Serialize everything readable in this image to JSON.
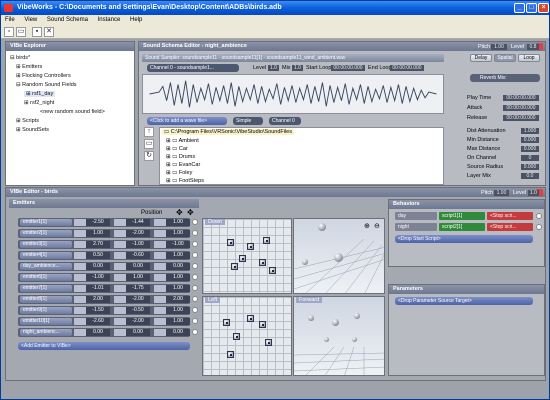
{
  "app": {
    "title": "VibeWorks - C:\\Documents and Settings\\Evan\\Desktop\\Content\\ADBs\\birds.adb",
    "menu": [
      "File",
      "View",
      "Sound Schema",
      "Instance",
      "Help"
    ],
    "window_buttons": [
      "_",
      "□",
      "×"
    ]
  },
  "explorer": {
    "title": "VIBe Explorer",
    "items": [
      {
        "label": "birds*",
        "toggle": "-"
      },
      {
        "label": "Emitters",
        "toggle": "+"
      },
      {
        "label": "Flocking Controllers",
        "toggle": "+"
      },
      {
        "label": "Random Sound Fields",
        "toggle": "-"
      },
      {
        "label": "rsf1_day",
        "toggle": "+"
      },
      {
        "label": "rsf2_night",
        "toggle": "+"
      },
      {
        "label": "<new random sound field>",
        "toggle": ""
      },
      {
        "label": "Scripts",
        "toggle": "+"
      },
      {
        "label": "SoundSets",
        "toggle": "+"
      }
    ]
  },
  "schema_editor": {
    "title": "Sound Schema Editor - night_ambience",
    "pitch_label": "Pitch",
    "pitch_value": "1.00",
    "level_label": "Level",
    "level_value": "0.8",
    "sampler_title": "Sound Sampler: soundsample11 - soundsample11[1] - soundsample11_wind_ambient.wav",
    "channel_select": "Channel 0 - soundsample1...",
    "level": "Level",
    "level_val": "1.0",
    "mix": "Mix",
    "mix_val": "1.0",
    "start_loop": "Start Loop",
    "start_loop_val": "00:00:00.000",
    "end_loop": "End Loop",
    "end_loop_val": "00:00:00.000",
    "add_wave": "<Click to add a wave file>",
    "mode_select": "Simple",
    "channel_select2": "Channel 0",
    "path": "C:\\Program Files\\VRSonic\\VibeStudio\\SoundFiles",
    "folders": [
      "Ambient",
      "Car",
      "Drums",
      "EvanCar",
      "Foley",
      "FootSteps"
    ],
    "buttons": [
      "Delay",
      "Spatial",
      "Loop"
    ],
    "reverb_label": "Reverb Mix:",
    "props": [
      {
        "label": "Play Time",
        "value": "00:00:00.000"
      },
      {
        "label": "Attack",
        "value": "00:00:00.000"
      },
      {
        "label": "Release",
        "value": "00:00:00.000"
      },
      {
        "label": "Dist Attenuation",
        "value": "1.000"
      },
      {
        "label": "Min Distance",
        "value": "0.000"
      },
      {
        "label": "Max Distance",
        "value": "0.000"
      },
      {
        "label": "On Channel",
        "value": "0"
      },
      {
        "label": "Source Radius",
        "value": "0.000"
      },
      {
        "label": "Layer Mix",
        "value": "0.0"
      }
    ]
  },
  "vibe_editor": {
    "title": "VIBe Editor - birds",
    "pitch_label": "Pitch",
    "pitch_value": "1.00",
    "level_label": "Level",
    "level_value": "1.0"
  },
  "emitters": {
    "title": "Emitters",
    "position_label": "Position",
    "rows": [
      {
        "name": "emitter1[1]",
        "x": "-2.50",
        "y": "-1.44",
        "z": "1.00"
      },
      {
        "name": "emitter2[1]",
        "x": "1.00",
        "y": "-2.00",
        "z": "1.00"
      },
      {
        "name": "emitter3[1]",
        "x": "2.70",
        "y": "-1.00",
        "z": "-1.00"
      },
      {
        "name": "emitter4[1]",
        "x": "0.50",
        "y": "-0.60",
        "z": "1.00"
      },
      {
        "name": "day_ambience...",
        "x": "0.00",
        "y": "0.00",
        "z": "0.00"
      },
      {
        "name": "emitter6[1]",
        "x": "-1.00",
        "y": "1.00",
        "z": "1.00"
      },
      {
        "name": "emitter7[1]",
        "x": "-1.01",
        "y": "-1.75",
        "z": "1.00"
      },
      {
        "name": "emitter8[1]",
        "x": "2.00",
        "y": "-2.00",
        "z": "2.00"
      },
      {
        "name": "emitter9[1]",
        "x": "-1.50",
        "y": "-0.50",
        "z": "1.00"
      },
      {
        "name": "emitter10[1]",
        "x": "-2.60",
        "y": "-2.00",
        "z": "1.00"
      },
      {
        "name": "night_ambienc...",
        "x": "0.00",
        "y": "0.00",
        "z": "0.00"
      }
    ],
    "add_label": "<Add Emitter to VIBe>"
  },
  "views": {
    "down": "Down",
    "left": "Left",
    "forward": "Forward"
  },
  "behaviors": {
    "title": "Behaviors",
    "rows": [
      {
        "name": "day",
        "start": "script1[1]",
        "stop": "<Stop scri..."
      },
      {
        "name": "night",
        "start": "script2[1]",
        "stop": "<Stop scri..."
      }
    ],
    "drop_start": "<Drop Start Script>"
  },
  "parameters": {
    "title": "Parameters",
    "drop_target": "<Drop Parameter Source Target>"
  }
}
